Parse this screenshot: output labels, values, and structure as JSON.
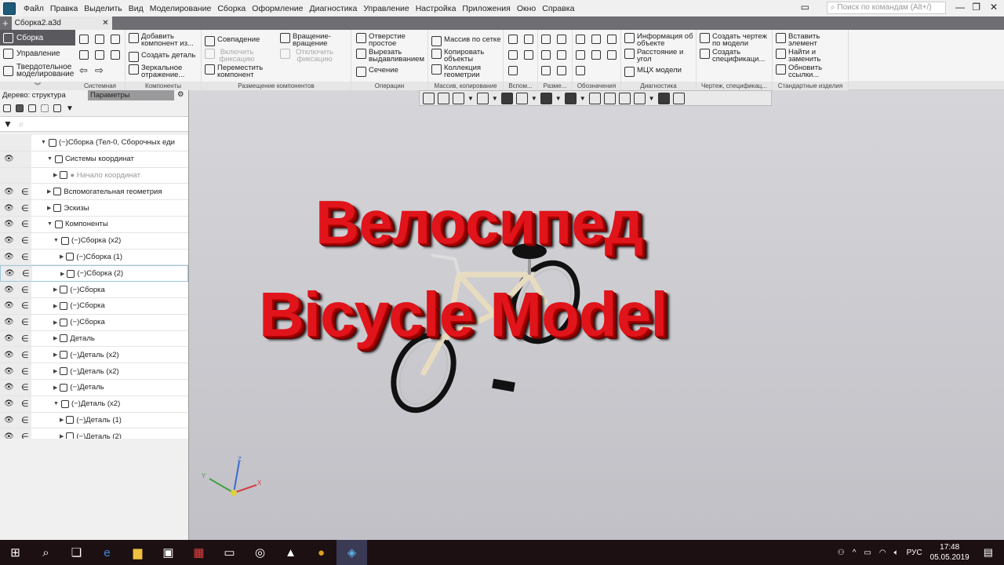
{
  "menu": [
    "Файл",
    "Правка",
    "Выделить",
    "Вид",
    "Моделирование",
    "Сборка",
    "Оформление",
    "Диагностика",
    "Управление",
    "Настройка",
    "Приложения",
    "Окно",
    "Справка"
  ],
  "search_placeholder": "Поиск по командам (Alt+/)",
  "doc_tab": "Сборка2.a3d",
  "modes": [
    "Сборка",
    "Управление",
    "Твердотельное моделирование"
  ],
  "ribbon": {
    "groups": [
      "Системная",
      "Компоненты",
      "Размещение компонентов",
      "Операции",
      "Массив, копирование",
      "Вспом...",
      "Разме...",
      "Обозначения",
      "Диагностика",
      "Чертеж, спецификац...",
      "Стандартные изделия"
    ],
    "components": [
      "Добавить компонент из...",
      "Создать деталь",
      "Зеркальное отражение..."
    ],
    "placement": [
      "Совпадение",
      "Включить фиксацию",
      "Переместить компонент",
      "Вращение-вращение",
      "Отключить фиксацию"
    ],
    "operations": [
      "Отверстие простое",
      "Вырезать выдавливанием",
      "Сечение"
    ],
    "array": [
      "Массив по сетке",
      "Копировать объекты",
      "Коллекция геометрии"
    ],
    "diagnostics": [
      "Информация об объекте",
      "Расстояние и угол",
      "МЦХ модели"
    ],
    "drawing": [
      "Создать чертеж по модели",
      "Создать спецификаци..."
    ],
    "standard": [
      "Вставить элемент",
      "Найти и заменить",
      "Обновить ссылки..."
    ]
  },
  "panel": {
    "tab_tree": "Дерево: структура",
    "tab_params": "Параметры"
  },
  "tree": [
    {
      "label": "(−)Сборка (Тел-0, Сборочных еди",
      "lvl": 0,
      "eye": false,
      "inc": false
    },
    {
      "label": "Системы координат",
      "lvl": 1,
      "eye": true,
      "inc": false
    },
    {
      "label": "● Начало координат",
      "lvl": 2,
      "eye": false,
      "inc": false,
      "grey": true
    },
    {
      "label": "Вспомогательная геометрия",
      "lvl": 1,
      "eye": true,
      "inc": true
    },
    {
      "label": "Эскизы",
      "lvl": 1,
      "eye": true,
      "inc": true
    },
    {
      "label": "Компоненты",
      "lvl": 1,
      "eye": true,
      "inc": true
    },
    {
      "label": "(−)Сборка (x2)",
      "lvl": 2,
      "eye": true,
      "inc": true
    },
    {
      "label": "(−)Сборка (1)",
      "lvl": 3,
      "eye": true,
      "inc": true
    },
    {
      "label": "(−)Сборка (2)",
      "lvl": 3,
      "eye": true,
      "inc": true,
      "sel": true
    },
    {
      "label": "(−)Сборка",
      "lvl": 2,
      "eye": true,
      "inc": true
    },
    {
      "label": "(−)Сборка",
      "lvl": 2,
      "eye": true,
      "inc": true
    },
    {
      "label": "(−)Сборка",
      "lvl": 2,
      "eye": true,
      "inc": true
    },
    {
      "label": "Деталь",
      "lvl": 2,
      "eye": true,
      "inc": true
    },
    {
      "label": "(−)Деталь (x2)",
      "lvl": 2,
      "eye": true,
      "inc": true
    },
    {
      "label": "(−)Деталь (x2)",
      "lvl": 2,
      "eye": true,
      "inc": true
    },
    {
      "label": "(−)Деталь",
      "lvl": 2,
      "eye": true,
      "inc": true
    },
    {
      "label": "(−)Деталь (x2)",
      "lvl": 2,
      "eye": true,
      "inc": true
    },
    {
      "label": "(−)Деталь (1)",
      "lvl": 3,
      "eye": true,
      "inc": true
    },
    {
      "label": "(−)Деталь (2)",
      "lvl": 3,
      "eye": true,
      "inc": true
    }
  ],
  "overlay": {
    "line1": "Велосипед",
    "line2": "Bicycle Model"
  },
  "axes": {
    "x": "X",
    "y": "Y",
    "z": "Z"
  },
  "tray": {
    "lang": "РУС",
    "time": "17:48",
    "date": "05.05.2019"
  }
}
